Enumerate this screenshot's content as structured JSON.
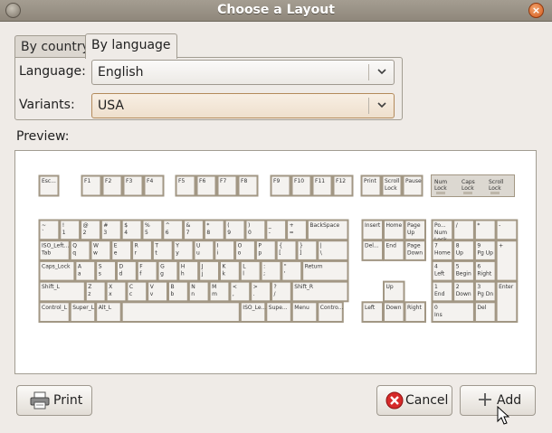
{
  "window": {
    "title": "Choose a Layout"
  },
  "tabs": [
    {
      "label": "By country",
      "active": false
    },
    {
      "label": "By language",
      "active": true
    }
  ],
  "form": {
    "language_label": "Language:",
    "language_value": "English",
    "variants_label": "Variants:",
    "variants_value": "USA"
  },
  "preview": {
    "label": "Preview:"
  },
  "buttons": {
    "print": "Print",
    "cancel": "Cancel",
    "add": "Add"
  },
  "keyboard": {
    "function_row": [
      {
        "t": "Esc..."
      },
      {
        "t": "F1"
      },
      {
        "t": "F2"
      },
      {
        "t": "F3"
      },
      {
        "t": "F4"
      },
      {
        "t": "F5"
      },
      {
        "t": "F6"
      },
      {
        "t": "F7"
      },
      {
        "t": "F8"
      },
      {
        "t": "F9"
      },
      {
        "t": "F10"
      },
      {
        "t": "F11"
      },
      {
        "t": "F12"
      },
      {
        "t": "Print"
      },
      {
        "t": "Scroll\nLock"
      },
      {
        "t": "Pause"
      }
    ],
    "indicators": [
      "Num\nLock",
      "Caps\nLock",
      "Scroll\nLock"
    ],
    "rows": [
      [
        {
          "t": "~\n`"
        },
        {
          "t": "!\n1"
        },
        {
          "t": "@\n2"
        },
        {
          "t": "#\n3"
        },
        {
          "t": "$\n4"
        },
        {
          "t": "%\n5"
        },
        {
          "t": "^\n6"
        },
        {
          "t": "&\n7"
        },
        {
          "t": "*\n8"
        },
        {
          "t": "(\n9"
        },
        {
          "t": ")\n0"
        },
        {
          "t": "_\n-"
        },
        {
          "t": "+\n="
        },
        {
          "t": "BackSpace",
          "w": 2
        }
      ],
      [
        {
          "t": "ISO_Left...\nTab",
          "w": 1.5
        },
        {
          "t": "Q\nq"
        },
        {
          "t": "W\nw"
        },
        {
          "t": "E\ne"
        },
        {
          "t": "R\nr"
        },
        {
          "t": "T\nt"
        },
        {
          "t": "Y\ny"
        },
        {
          "t": "U\nu"
        },
        {
          "t": "I\ni"
        },
        {
          "t": "O\no"
        },
        {
          "t": "P\np"
        },
        {
          "t": "{\n["
        },
        {
          "t": "}\n]"
        },
        {
          "t": "|\n\\",
          "w": 1.5
        }
      ],
      [
        {
          "t": "Caps_Lock",
          "w": 1.75
        },
        {
          "t": "A\na"
        },
        {
          "t": "S\ns"
        },
        {
          "t": "D\nd"
        },
        {
          "t": "F\nf"
        },
        {
          "t": "G\ng"
        },
        {
          "t": "H\nh"
        },
        {
          "t": "J\nj"
        },
        {
          "t": "K\nk"
        },
        {
          "t": "L\nl"
        },
        {
          "t": ":\n;"
        },
        {
          "t": "\"\n'"
        },
        {
          "t": "Return",
          "w": 2.25
        }
      ],
      [
        {
          "t": "Shift_L",
          "w": 2.25
        },
        {
          "t": "Z\nz"
        },
        {
          "t": "X\nx"
        },
        {
          "t": "C\nc"
        },
        {
          "t": "V\nv"
        },
        {
          "t": "B\nb"
        },
        {
          "t": "N\nn"
        },
        {
          "t": "M\nm"
        },
        {
          "t": "<\n,"
        },
        {
          "t": ">\n."
        },
        {
          "t": "?\n/"
        },
        {
          "t": "Shift_R",
          "w": 2.75
        }
      ],
      [
        {
          "t": "Control_L",
          "w": 1.5
        },
        {
          "t": "Super_L",
          "w": 1.25
        },
        {
          "t": "Alt_L",
          "w": 1.25
        },
        {
          "t": "",
          "w": 5.75
        },
        {
          "t": "ISO_Le...",
          "w": 1.25
        },
        {
          "t": "Supe...",
          "w": 1.25
        },
        {
          "t": "Menu",
          "w": 1.25
        },
        {
          "t": "Contro...",
          "w": 1.25
        }
      ]
    ],
    "nav": [
      [
        "Insert",
        "Home",
        "Page\nUp"
      ],
      [
        "Del...",
        "End",
        "Page\nDown"
      ],
      [
        "",
        "",
        ""
      ],
      [
        "",
        "Up",
        ""
      ],
      [
        "Left",
        "Down",
        "Right"
      ]
    ],
    "numpad": [
      [
        "Po...\nNum\nLock",
        "/",
        "*",
        "-"
      ],
      [
        "7\nHome",
        "8\nUp",
        "9\nPg Up",
        "+"
      ],
      [
        "4\nLeft",
        "5\nBegin",
        "6\nRight",
        ""
      ],
      [
        "1\nEnd",
        "2\nDown",
        "3\nPg Dn",
        "Enter"
      ],
      [
        "0\nIns",
        "",
        "Del",
        ""
      ]
    ]
  },
  "colors": {
    "key_face": "#f4f2ef",
    "key_border": "#a29784",
    "dialog_bg": "#efebe7",
    "title_bg": "#988f83"
  }
}
